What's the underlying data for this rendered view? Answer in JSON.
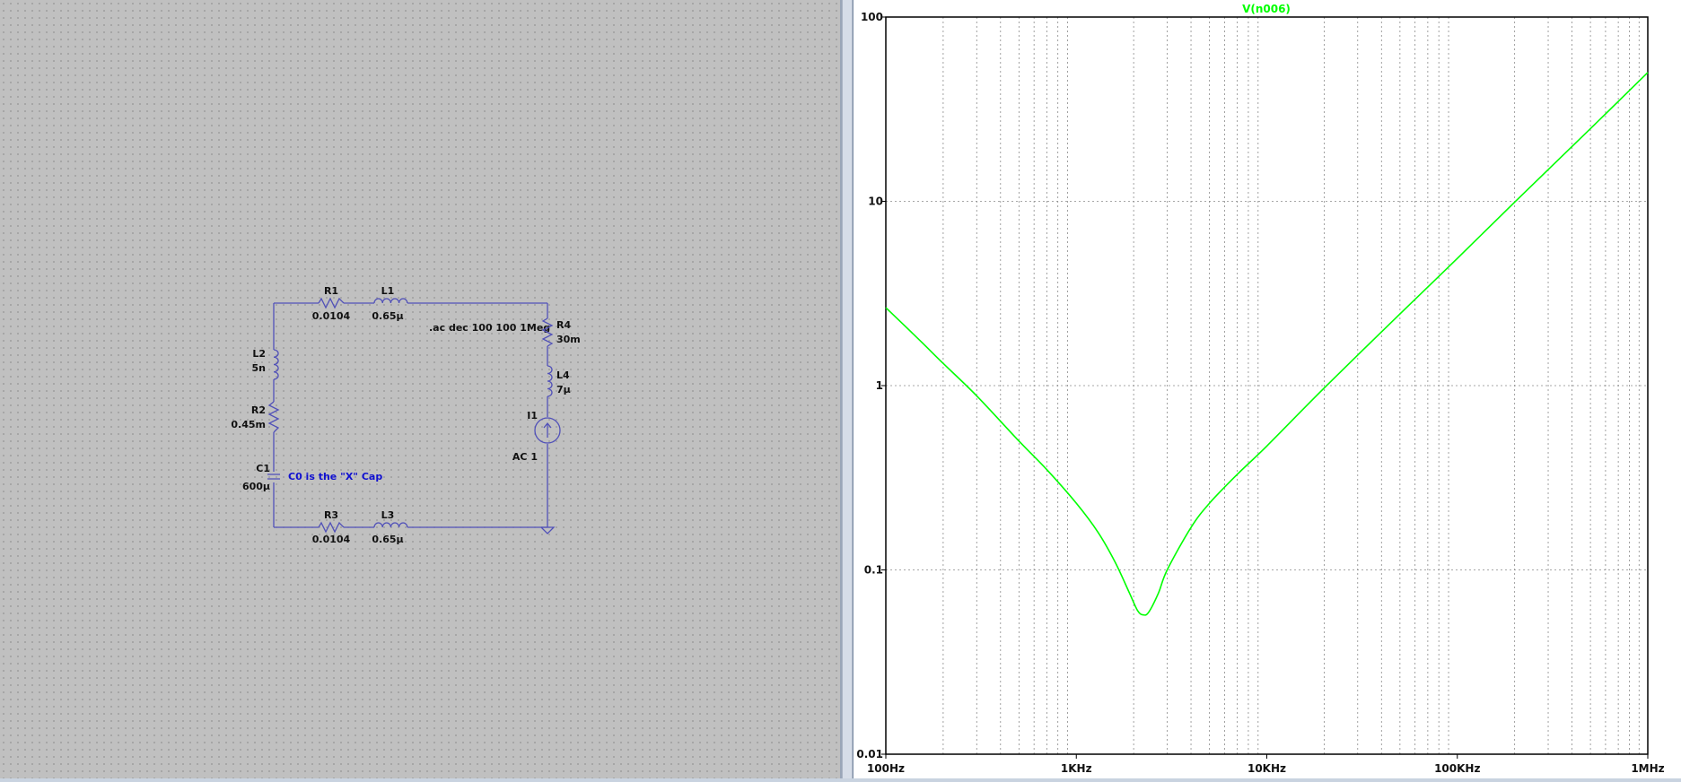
{
  "schematic": {
    "components": {
      "R1": {
        "name": "R1",
        "value": "0.0104"
      },
      "L1": {
        "name": "L1",
        "value": "0.65µ"
      },
      "R4": {
        "name": "R4",
        "value": "30m"
      },
      "L4": {
        "name": "L4",
        "value": "7µ"
      },
      "I1": {
        "name": "I1",
        "value": "AC 1"
      },
      "L2": {
        "name": "L2",
        "value": "5n"
      },
      "R2": {
        "name": "R2",
        "value": "0.45m"
      },
      "C1": {
        "name": "C1",
        "value": "600µ"
      },
      "R3": {
        "name": "R3",
        "value": "0.0104"
      },
      "L3": {
        "name": "L3",
        "value": "0.65µ"
      }
    },
    "directive": ".ac dec 100 100 1Meg",
    "comment": "C0 is the \"X\" Cap",
    "wire_color": "#5050b8",
    "comment_color": "#1010d0"
  },
  "plot": {
    "trace_label": "V(n006)",
    "trace_color": "#00ff00"
  },
  "chart_data": {
    "type": "line",
    "title": "V(n006)",
    "x_scale": "log",
    "y_scale": "log",
    "xlim": [
      100,
      1000000
    ],
    "ylim": [
      0.01,
      100
    ],
    "x_ticks": [
      {
        "value": 100,
        "label": "100Hz"
      },
      {
        "value": 1000,
        "label": "1KHz"
      },
      {
        "value": 10000,
        "label": "10KHz"
      },
      {
        "value": 100000,
        "label": "100KHz"
      },
      {
        "value": 1000000,
        "label": "1MHz"
      }
    ],
    "y_ticks": [
      {
        "value": 100,
        "label": "100"
      },
      {
        "value": 10,
        "label": "10"
      },
      {
        "value": 1,
        "label": "1"
      },
      {
        "value": 0.1,
        "label": "0.1"
      },
      {
        "value": 0.01,
        "label": "0.01"
      }
    ],
    "grid": true,
    "series": [
      {
        "name": "V(n006)",
        "color": "#00ff00",
        "x": [
          100,
          150,
          200,
          300,
          500,
          700,
          1000,
          1300,
          1600,
          1900,
          2100,
          2250,
          2400,
          2700,
          3000,
          4000,
          5000,
          7000,
          10000,
          20000,
          50000,
          100000,
          200000,
          500000,
          1000000
        ],
        "y": [
          2.65,
          1.77,
          1.32,
          0.88,
          0.5,
          0.35,
          0.23,
          0.16,
          0.11,
          0.075,
          0.06,
          0.057,
          0.059,
          0.075,
          0.1,
          0.17,
          0.23,
          0.33,
          0.47,
          0.97,
          2.45,
          4.9,
          9.9,
          24.8,
          50
        ]
      }
    ]
  }
}
